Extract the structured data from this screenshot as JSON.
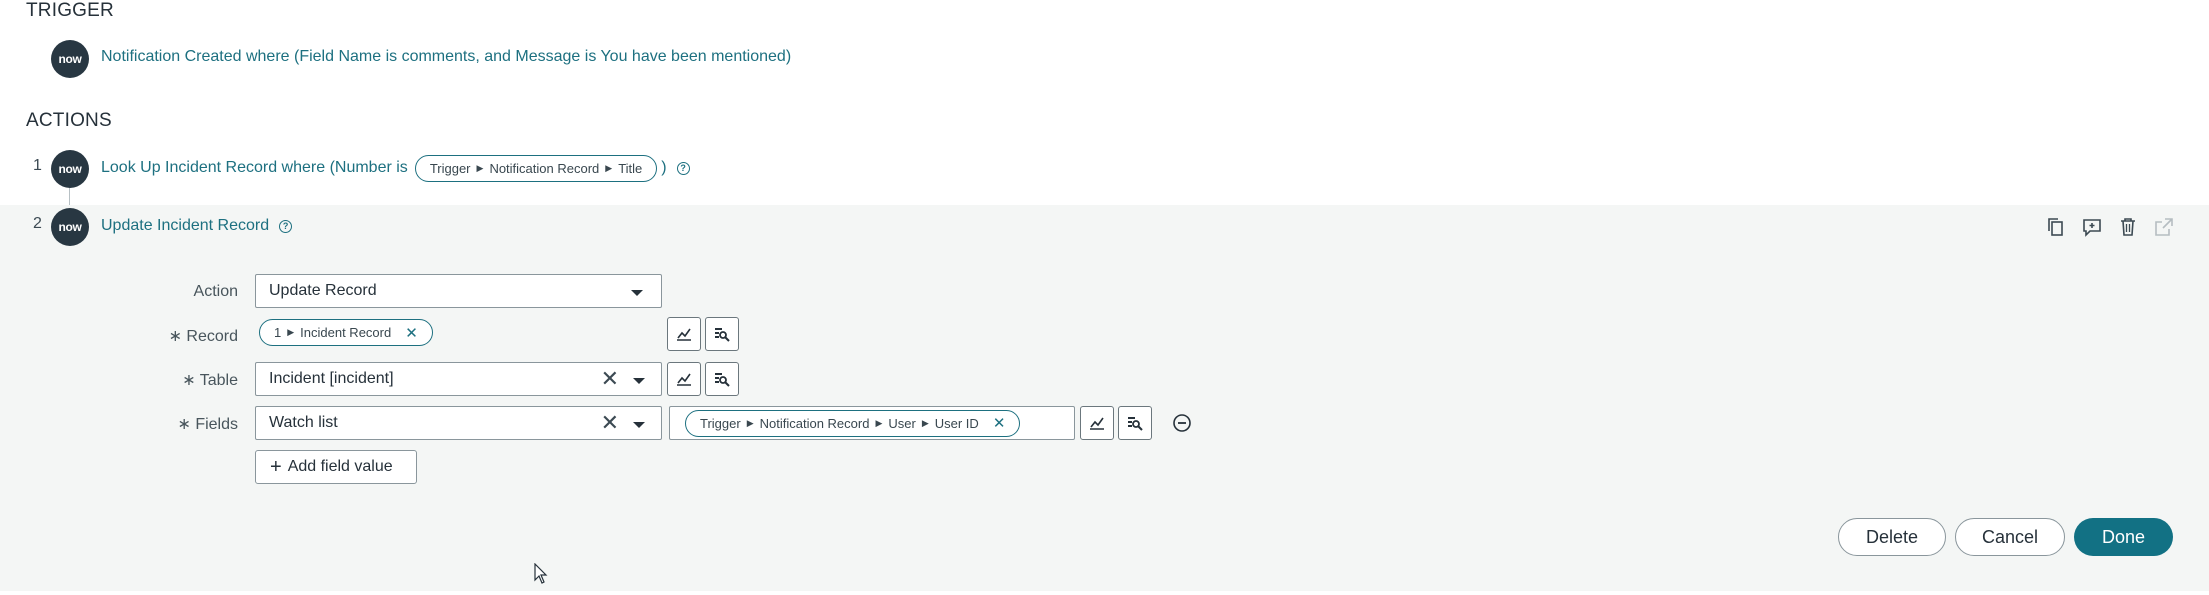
{
  "trigger": {
    "heading": "TRIGGER",
    "badge": "now",
    "text": "Notification Created where (Field Name is comments, and Message is You have been mentioned)"
  },
  "actions": {
    "heading": "ACTIONS",
    "step1": {
      "number": "1",
      "badge": "now",
      "text_prefix": "Look Up Incident Record where (Number is",
      "pill": [
        "Trigger",
        "Notification Record",
        "Title"
      ],
      "text_suffix": ")",
      "help_icon": "?"
    },
    "step2": {
      "number": "2",
      "badge": "now",
      "title": "Update Incident Record",
      "help_icon": "?"
    }
  },
  "form": {
    "action_label": "Action",
    "action_value": "Update Record",
    "record_label": "Record",
    "record_pill": [
      "1",
      "Incident Record"
    ],
    "table_label": "Table",
    "table_value": "Incident [incident]",
    "fields_label": "Fields",
    "fields_value": "Watch list",
    "fields_pill": [
      "Trigger",
      "Notification Record",
      "User",
      "User ID"
    ],
    "add_field_label": "Add field value",
    "required_mark": "∗"
  },
  "buttons": {
    "delete": "Delete",
    "cancel": "Cancel",
    "done": "Done"
  },
  "colors": {
    "accent": "#127184",
    "link": "#1d7080",
    "badge_bg": "#283742",
    "panel_bg": "#f4f6f5"
  },
  "icons": [
    "copy-icon",
    "add-comment-icon",
    "trash-icon",
    "open-external-icon",
    "data-pill-picker-icon",
    "reference-tree-icon",
    "remove-circle-icon",
    "plus-icon",
    "close-icon",
    "chevron-down-icon",
    "mouse-cursor-icon"
  ]
}
